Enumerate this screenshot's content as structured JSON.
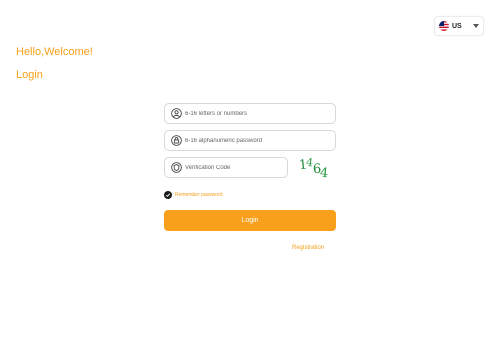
{
  "language_selector": {
    "code": "US",
    "flag_icon": "us-flag-icon",
    "caret_icon": "caret-down-icon"
  },
  "header": {
    "greeting": "Hello,Welcome!",
    "title": "Login"
  },
  "form": {
    "username": {
      "placeholder": "6-16 letters or numbers",
      "value": "",
      "icon": "user-icon"
    },
    "password": {
      "placeholder": "6-16 alphanumeric password",
      "value": "",
      "icon": "lock-icon"
    },
    "verification": {
      "placeholder": "Verification Code",
      "value": "",
      "icon": "shield-icon"
    },
    "captcha_text": "1464",
    "remember_label": "Remember password",
    "remember_checked": true,
    "login_label": "Login",
    "register_label": "Registration"
  },
  "colors": {
    "accent": "#f5a01a",
    "button": "#f8a01b",
    "captcha_green": "#1f8a3a"
  }
}
